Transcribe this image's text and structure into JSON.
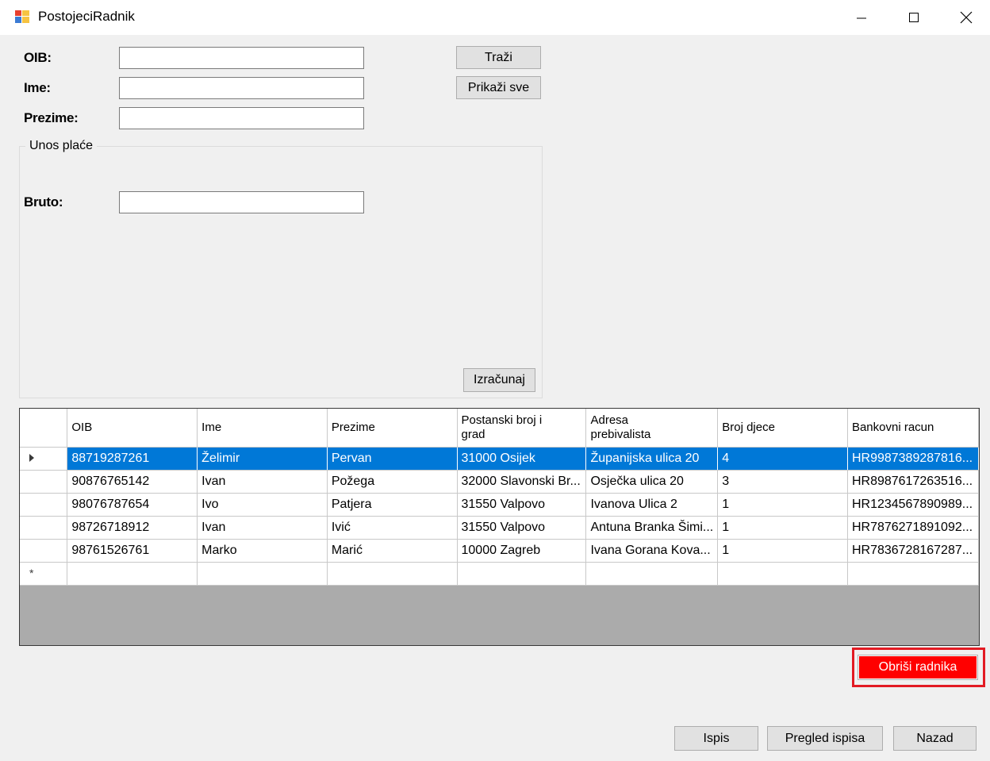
{
  "window": {
    "title": "PostojeciRadnik",
    "controls": [
      "minimize-icon",
      "maximize-icon",
      "close-icon"
    ]
  },
  "form": {
    "oib_label": "OIB:",
    "ime_label": "Ime:",
    "prezime_label": "Prezime:",
    "oib_value": "",
    "ime_value": "",
    "prezime_value": "",
    "search_button": "Traži",
    "show_all_button": "Prikaži sve"
  },
  "salary_group": {
    "title": "Unos plaće",
    "bruto_label": "Bruto:",
    "bruto_value": "",
    "calculate_button": "Izračunaj"
  },
  "grid": {
    "columns": [
      "OIB",
      "Ime",
      "Prezime",
      "Postanski broj i grad",
      "Adresa prebivalista",
      "Broj djece",
      "Bankovni racun"
    ],
    "selected_row": 0,
    "rows": [
      [
        "88719287261",
        "Želimir",
        "Pervan",
        "31000 Osijek",
        "Županijska ulica 20",
        "4",
        "HR9987389287816..."
      ],
      [
        "90876765142",
        "Ivan",
        "Požega",
        "32000 Slavonski Br...",
        "Osječka ulica 20",
        "3",
        "HR8987617263516..."
      ],
      [
        "98076787654",
        "Ivo",
        "Patjera",
        "31550 Valpovo",
        "Ivanova Ulica 2",
        "1",
        "HR1234567890989..."
      ],
      [
        "98726718912",
        "Ivan",
        "Ivić",
        "31550 Valpovo",
        "Antuna Branka Šimi...",
        "1",
        "HR7876271891092..."
      ],
      [
        "98761526761",
        "Marko",
        "Marić",
        "10000 Zagreb",
        "Ivana Gorana Kova...",
        "1",
        "HR7836728167287..."
      ]
    ]
  },
  "actions": {
    "delete_button": "Obriši radnika",
    "print_button": "Ispis",
    "print_preview_button": "Pregled ispisa",
    "back_button": "Nazad"
  },
  "colors": {
    "selection": "#0078d7",
    "delete_button": "#ff0000",
    "highlight_frame": "#e21b23"
  }
}
